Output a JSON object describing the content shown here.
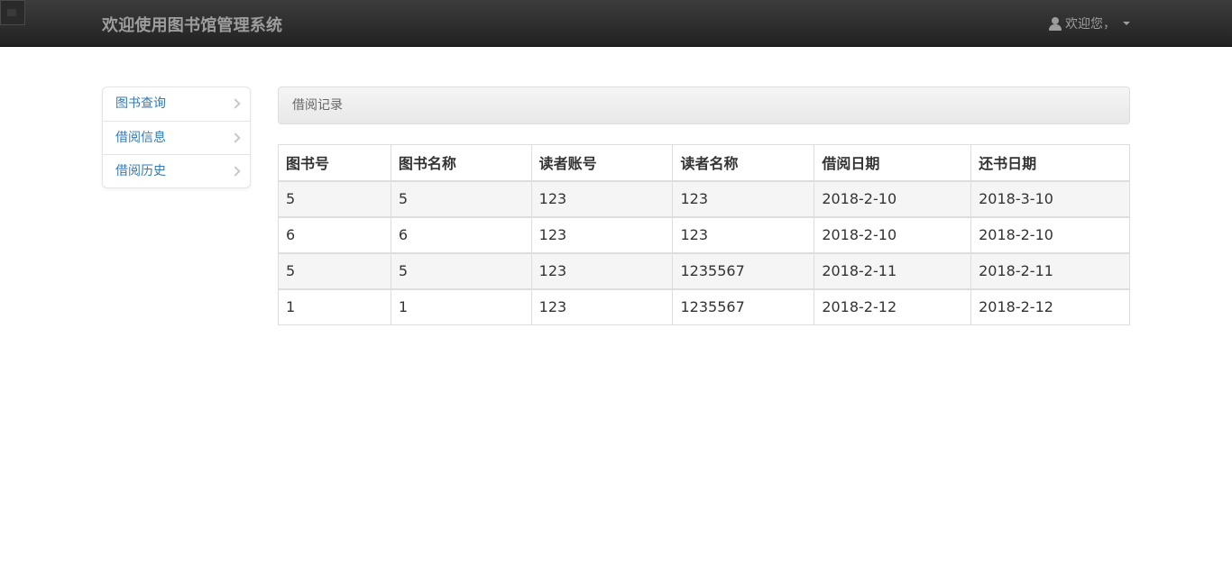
{
  "navbar": {
    "brand": "欢迎使用图书馆管理系统",
    "user_label": "欢迎您，"
  },
  "sidebar": {
    "items": [
      {
        "label": "图书查询"
      },
      {
        "label": "借阅信息"
      },
      {
        "label": "借阅历史"
      }
    ]
  },
  "panel": {
    "title": "借阅记录"
  },
  "table": {
    "headers": [
      "图书号",
      "图书名称",
      "读者账号",
      "读者名称",
      "借阅日期",
      "还书日期"
    ],
    "rows": [
      [
        "5",
        "5",
        "123",
        "123",
        "2018-2-10",
        "2018-3-10"
      ],
      [
        "6",
        "6",
        "123",
        "123",
        "2018-2-10",
        "2018-2-10"
      ],
      [
        "5",
        "5",
        "123",
        "1235567",
        "2018-2-11",
        "2018-2-11"
      ],
      [
        "1",
        "1",
        "123",
        "1235567",
        "2018-2-12",
        "2018-2-12"
      ]
    ]
  },
  "colors": {
    "navbar_bg": "#222222",
    "brand_text": "#9d9d9d",
    "link": "#337ab7",
    "striped_row": "#f5f5f5"
  },
  "icons": {
    "user": "user-icon",
    "caret": "caret-down-icon",
    "chevron": "chevron-right-icon"
  }
}
